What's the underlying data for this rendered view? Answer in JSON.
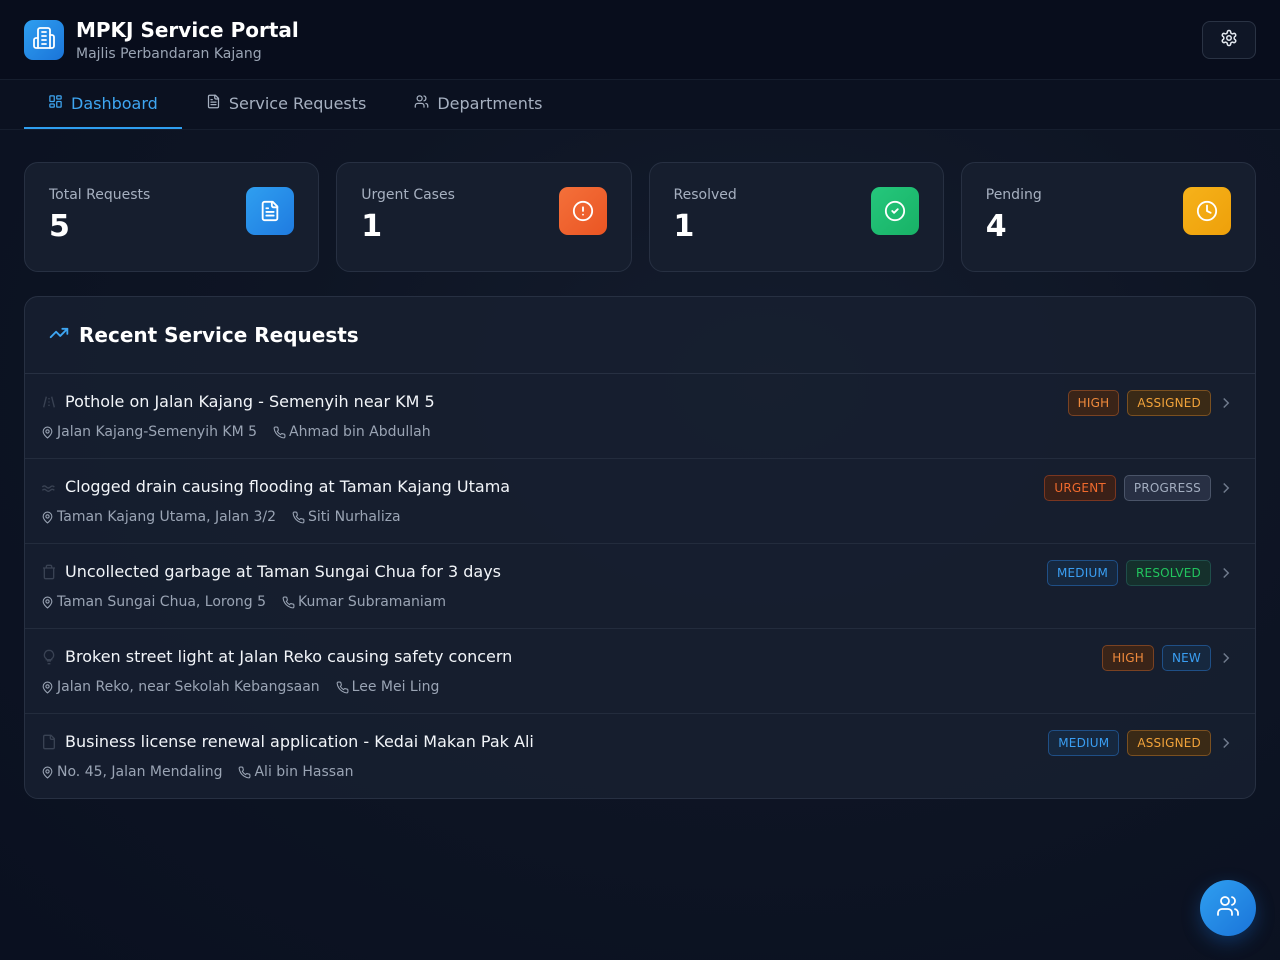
{
  "header": {
    "title": "MPKJ Service Portal",
    "subtitle": "Majlis Perbandaran Kajang",
    "logo_icon": "building-icon",
    "settings_icon": "gear-icon"
  },
  "tabs": [
    {
      "label": "Dashboard",
      "icon": "grid-icon",
      "active": true
    },
    {
      "label": "Service Requests",
      "icon": "document-icon",
      "active": false
    },
    {
      "label": "Departments",
      "icon": "users-icon",
      "active": false
    }
  ],
  "stats": [
    {
      "label": "Total Requests",
      "value": "5",
      "icon": "document-icon",
      "color": "#2a8ee8"
    },
    {
      "label": "Urgent Cases",
      "value": "1",
      "icon": "alert-circle-icon",
      "color": "#f0622d"
    },
    {
      "label": "Resolved",
      "value": "1",
      "icon": "check-circle-icon",
      "color": "#1fbf73"
    },
    {
      "label": "Pending",
      "value": "4",
      "icon": "clock-icon",
      "color": "#f2a60d"
    }
  ],
  "recent": {
    "title": "Recent Service Requests",
    "icon": "trending-up-icon",
    "items": [
      {
        "title": "Pothole on Jalan Kajang - Semenyih near KM 5",
        "location": "Jalan Kajang-Semenyih KM 5",
        "contact": "Ahmad bin Abdullah",
        "priority": "HIGH",
        "status": "ASSIGNED",
        "category_icon": "road-icon"
      },
      {
        "title": "Clogged drain causing flooding at Taman Kajang Utama",
        "location": "Taman Kajang Utama, Jalan 3/2",
        "contact": "Siti Nurhaliza",
        "priority": "URGENT",
        "status": "PROGRESS",
        "category_icon": "water-icon"
      },
      {
        "title": "Uncollected garbage at Taman Sungai Chua for 3 days",
        "location": "Taman Sungai Chua, Lorong 5",
        "contact": "Kumar Subramaniam",
        "priority": "MEDIUM",
        "status": "RESOLVED",
        "category_icon": "trash-icon"
      },
      {
        "title": "Broken street light at Jalan Reko causing safety concern",
        "location": "Jalan Reko, near Sekolah Kebangsaan",
        "contact": "Lee Mei Ling",
        "priority": "HIGH",
        "status": "NEW",
        "category_icon": "lightbulb-icon"
      },
      {
        "title": "Business license renewal application - Kedai Makan Pak Ali",
        "location": "No. 45, Jalan Mendaling",
        "contact": "Ali bin Hassan",
        "priority": "MEDIUM",
        "status": "ASSIGNED",
        "category_icon": "document-icon"
      }
    ]
  },
  "fab": {
    "icon": "users-icon"
  },
  "colors": {
    "accent": "#2f9ff0",
    "high": "#f08a3c",
    "urgent": "#f06a2d",
    "medium": "#3a9ef2",
    "assigned": "#f2a33a",
    "progress": "#a3aec0",
    "resolved": "#22c55e",
    "new": "#3a9ef2"
  }
}
